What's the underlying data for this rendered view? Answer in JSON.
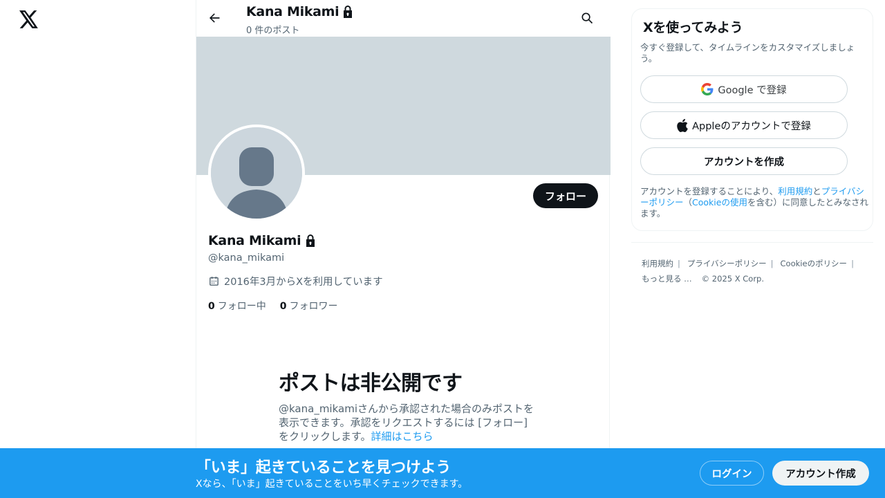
{
  "nav": {
    "logo": "x-logo-icon"
  },
  "header": {
    "name": "Kana Mikami",
    "post_count": "0 件のポスト",
    "back_icon": "arrow-left-icon",
    "search_icon": "search-icon"
  },
  "profile": {
    "name": "Kana Mikami",
    "handle": "@kana_mikami",
    "joined": "2016年3月からXを利用しています",
    "follow_label": "フォロー",
    "following_count": "0",
    "following_label": "フォロー中",
    "followers_count": "0",
    "followers_label": "フォロワー",
    "lock_icon": "lock-icon",
    "calendar_icon": "calendar-icon"
  },
  "private_notice": {
    "title": "ポストは非公開です",
    "desc": "@kana_mikamiさんから承認された場合のみポストを表示できます。承認をリクエストするには [フォロー] をクリックします。",
    "link": "詳細はこちら"
  },
  "sidebar": {
    "title": "Xを使ってみよう",
    "subtitle": "今すぐ登録して、タイムラインをカスタマイズしましょう。",
    "google_label": "Google で登録",
    "apple_label": "Appleのアカウントで登録",
    "create_label": "アカウントを作成",
    "terms_prefix": "アカウントを登録することにより、",
    "terms_link": "利用規約",
    "terms_and": "と",
    "privacy_link": "プライバシーポリシー",
    "terms_paren_open": "（",
    "cookie_link": "Cookieの使用",
    "terms_suffix": "を含む）に同意したとみなされます。"
  },
  "footer": {
    "terms": "利用規約",
    "privacy": "プライバシーポリシー",
    "cookies": "Cookieのポリシー",
    "more": "もっと見る …",
    "copyright": "© 2025 X Corp."
  },
  "bottom_bar": {
    "title": "「いま」起きていることを見つけよう",
    "subtitle": "Xなら、「いま」起きていることをいち早くチェックできます。",
    "login_label": "ログイン",
    "create_label": "アカウント作成"
  },
  "colors": {
    "accent": "#1d9bf0",
    "banner": "#cfd9de",
    "text": "#0f1419",
    "muted": "#536471"
  }
}
